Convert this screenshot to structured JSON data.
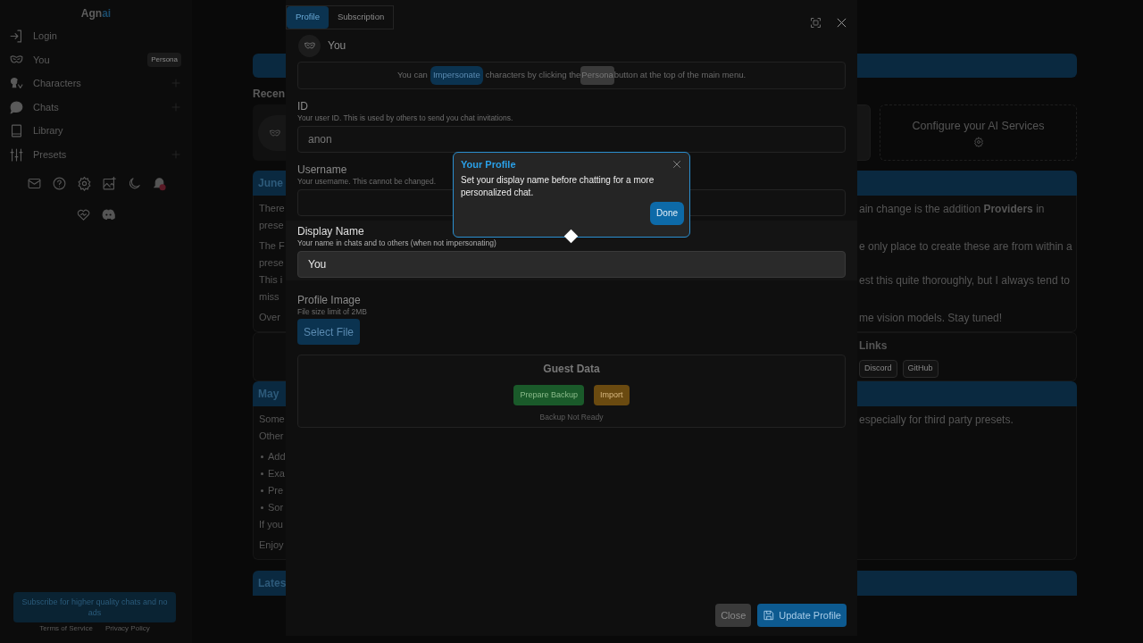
{
  "sidebar": {
    "brand": {
      "main": "Agn",
      "accent": "ai"
    },
    "items": [
      {
        "label": "Login",
        "add": false
      },
      {
        "label": "You",
        "add": false,
        "tooltip": "Persona"
      },
      {
        "label": "Characters",
        "add": true
      },
      {
        "label": "Chats",
        "add": true
      },
      {
        "label": "Library",
        "add": false
      },
      {
        "label": "Presets",
        "add": true
      }
    ],
    "subscribe_button": "Subscribe for higher quality chats and no ads",
    "footer_links": [
      "Terms of Service",
      "Privacy Policy"
    ]
  },
  "main": {
    "recent_heading": "Recen",
    "services_card": "Configure your AI Services",
    "posts": [
      {
        "kind": "post",
        "title": "June",
        "paragraphs": [
          [
            {
              "left": "There",
              "right": "ain change is the addition **Providers** in"
            },
            {
              "left": "prese"
            }
          ],
          [
            {
              "left": "The F",
              "right": "e only place to create these are from within a"
            },
            {
              "left": "prese"
            },
            {
              "left": "This i",
              "right": "est this quite thoroughly, but I always tend to"
            },
            {
              "left": "miss"
            }
          ],
          [
            {
              "left": "Over",
              "right": "me vision models. Stay tuned!"
            }
          ]
        ]
      },
      {
        "kind": "links",
        "title": "Links",
        "buttons": [
          "Discord",
          "GitHub"
        ]
      },
      {
        "kind": "post",
        "title": "May",
        "paragraphs": [
          [
            {
              "left": "Some",
              "right": "especially for third party presets."
            },
            {
              "left": "Other"
            }
          ],
          [
            {
              "left": "Add",
              "bullet": true
            },
            {
              "left": "Exa",
              "bullet": true
            },
            {
              "left": "Pre",
              "bullet": true
            },
            {
              "left": "Sor",
              "bullet": true
            },
            {
              "left": "If you"
            }
          ],
          [
            {
              "left": "Enjoy"
            }
          ]
        ]
      },
      {
        "kind": "header",
        "title": "Lates"
      }
    ]
  },
  "modal": {
    "tabs": [
      {
        "label": "Profile",
        "selected": true
      },
      {
        "label": "Subscription",
        "selected": false
      }
    ],
    "profile_name": "You",
    "info": {
      "before": "You can",
      "impersonate_button": "Impersonate",
      "middle": "characters by clicking the",
      "persona_button": "Persona",
      "after": "button at the top of the main menu."
    },
    "fields": [
      {
        "label": "ID",
        "help": "Your user ID. This is used by others to send you chat invitations.",
        "value": "anon",
        "disabled": true,
        "highlighted": false
      },
      {
        "label": "Username",
        "help": "Your username. This cannot be changed.",
        "disabled": true,
        "highlighted": false
      },
      {
        "label": "Display Name",
        "help": "Your name in chats and to others (when not impersonating)",
        "value": "You",
        "disabled": false,
        "highlighted": true
      }
    ],
    "profile_image": {
      "label": "Profile Image",
      "help": "File size limit of 2MB",
      "button": "Select File"
    },
    "guest_data": {
      "title": "Guest Data",
      "buttons": [
        {
          "label": "Prepare Backup",
          "kind": "success"
        },
        {
          "label": "Import",
          "kind": "warning"
        }
      ],
      "status": "Backup Not Ready"
    },
    "footer_buttons": [
      {
        "label": "Close",
        "kind": "secondary"
      },
      {
        "label": "Update Profile",
        "kind": "primary"
      }
    ]
  },
  "tour_popup": {
    "title": "Your Profile",
    "text": "Set your display name before chatting for a more personalized chat.",
    "button": "Done"
  }
}
